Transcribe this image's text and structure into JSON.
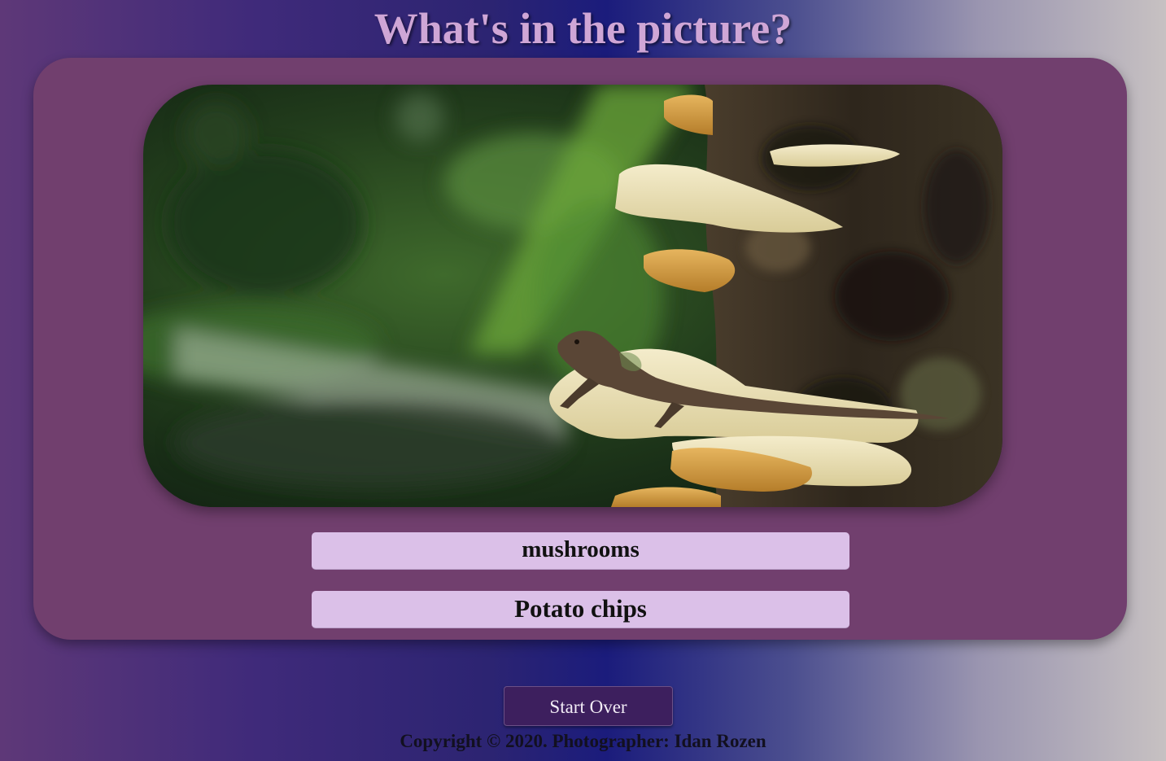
{
  "header": {
    "title": "What's in the picture?"
  },
  "photo": {
    "subject": "lizard on shelf mushrooms growing on a tree trunk"
  },
  "answers": [
    {
      "label": "mushrooms"
    },
    {
      "label": "Potato chips"
    }
  ],
  "controls": {
    "start_over_label": "Start Over"
  },
  "footer": {
    "copyright": "Copyright © 2020. Photographer: Idan Rozen"
  },
  "colors": {
    "card": "#713f6e",
    "title": "#cfa6d6",
    "answer_button": "#dbc0e8",
    "start_over_button": "#3d1f5e"
  }
}
